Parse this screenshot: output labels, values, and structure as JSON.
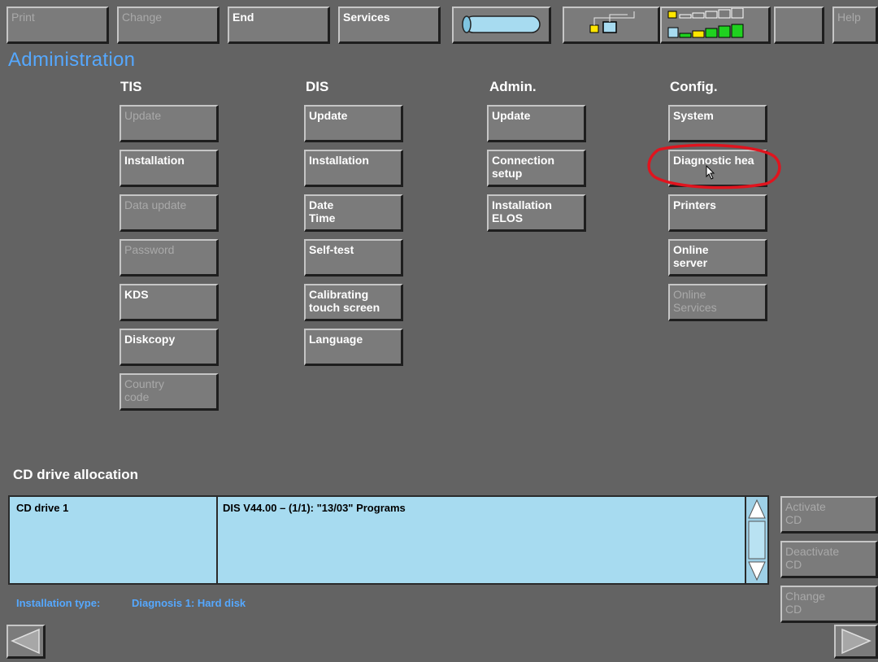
{
  "toolbar": {
    "print": "Print",
    "change": "Change",
    "end": "End",
    "services": "Services",
    "help": "Help"
  },
  "page_title": "Administration",
  "columns": {
    "tis": {
      "header": "TIS",
      "buttons": [
        "Update",
        "Installation",
        "Data update",
        "Password",
        "KDS",
        "Diskcopy",
        "Country\ncode"
      ]
    },
    "dis": {
      "header": "DIS",
      "buttons": [
        "Update",
        "Installation",
        "Date\nTime",
        "Self-test",
        "Calibrating\ntouch screen",
        "Language"
      ]
    },
    "admin": {
      "header": "Admin.",
      "buttons": [
        "Update",
        "Connection\nsetup",
        "Installation\nELOS"
      ]
    },
    "config": {
      "header": "Config.",
      "buttons": [
        "System",
        "Diagnostic hea",
        "Printers",
        "Online\nserver",
        "Online\nServices"
      ]
    }
  },
  "cd_section": {
    "title": "CD drive allocation",
    "drive": "CD drive 1",
    "content": "DIS V44.00  – (1/1): \"13/03\" Programs"
  },
  "side_buttons": {
    "activate": "Activate\nCD",
    "deactivate": "Deactivate\nCD",
    "change": "Change\nCD"
  },
  "status": {
    "label": "Installation type:",
    "value": "Diagnosis 1: Hard disk"
  },
  "colors": {
    "background": "#636363",
    "button": "#7b7b7b",
    "title_blue": "#55a8ff",
    "list_bg": "#a7dbf0",
    "annotation_red": "#e0141e",
    "indicator_green": "#1fd11f",
    "indicator_yellow": "#ffe600"
  }
}
